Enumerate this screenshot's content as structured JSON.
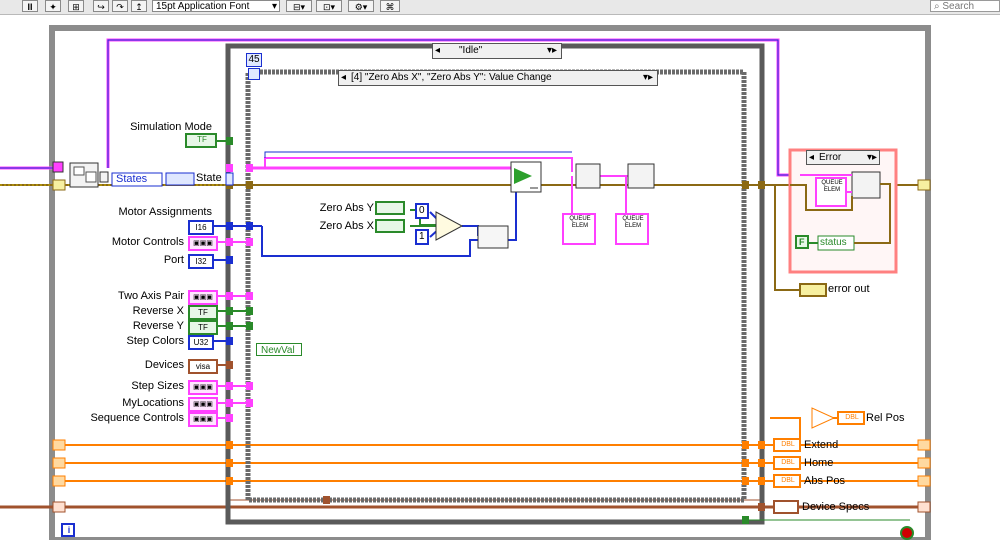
{
  "toolbar": {
    "pause_glyph": "II",
    "font": "15pt Application Font",
    "search_placeholder": "Search"
  },
  "diagram": {
    "case_selector": "\"Idle\"",
    "event_count": "45",
    "event_selector": "[4] \"Zero Abs X\", \"Zero Abs Y\": Value Change",
    "error_case": "Error",
    "iteration": "i",
    "controls_left": [
      {
        "label": "Simulation Mode",
        "tag": "TF"
      },
      {
        "label": "Motor Assignments",
        "tag": "I16"
      },
      {
        "label": "Motor Controls",
        "tag": "cluster"
      },
      {
        "label": "Port",
        "tag": "I32"
      },
      {
        "label": "Two Axis Pair",
        "tag": "cluster"
      },
      {
        "label": "Reverse X",
        "tag": "TF"
      },
      {
        "label": "Reverse Y",
        "tag": "TF"
      },
      {
        "label": "Step Colors",
        "tag": "U32"
      },
      {
        "label": "Devices",
        "tag": "visa"
      },
      {
        "label": "Step Sizes",
        "tag": "cluster"
      },
      {
        "label": "MyLocations",
        "tag": "cluster"
      },
      {
        "label": "Sequence Controls",
        "tag": "cluster"
      }
    ],
    "states_label": "States",
    "state_label": "State",
    "zero_abs_y": "Zero Abs Y",
    "zero_abs_x": "Zero Abs X",
    "const_zero": "0",
    "const_one": "1",
    "newval": "NewVal",
    "queue_elem": "QUEUE ELEM",
    "status_label": "status",
    "false_const": "F",
    "error_out": "error out",
    "right_outputs": [
      {
        "label": "Rel Pos"
      },
      {
        "label": "Extend"
      },
      {
        "label": "Home"
      },
      {
        "label": "Abs Pos"
      },
      {
        "label": "Device Specs"
      }
    ],
    "dbl_tag": "DBL"
  },
  "colors": {
    "wire_pink": "#ff40ff",
    "wire_blue": "#1a2fd0",
    "wire_green": "#2a8a2a",
    "wire_orange": "#ff7f00",
    "wire_cluster": "#8b6914",
    "wire_brown": "#a0522d",
    "error_frame": "#ff8080"
  }
}
